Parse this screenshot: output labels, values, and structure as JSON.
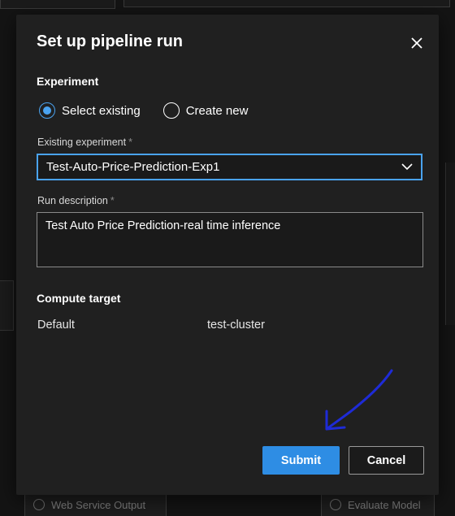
{
  "dialog": {
    "title": "Set up pipeline run",
    "close_icon": "close-icon",
    "experiment_section": "Experiment",
    "radio_options": [
      {
        "label": "Select existing",
        "selected": true
      },
      {
        "label": "Create new",
        "selected": false
      }
    ],
    "existing_experiment_label": "Existing experiment",
    "existing_experiment_value": "Test-Auto-Price-Prediction-Exp1",
    "run_description_label": "Run description",
    "run_description_value": "Test Auto Price Prediction-real time inference",
    "required_marker": "*",
    "compute_section": "Compute target",
    "compute_key": "Default",
    "compute_value": "test-cluster",
    "submit_label": "Submit",
    "cancel_label": "Cancel"
  },
  "background": {
    "node_1_label": "Web Service Output",
    "node_2_label": "Evaluate Model"
  },
  "colors": {
    "accent": "#2e8de4",
    "focus": "#4aa3f0",
    "dialog_bg": "#202020",
    "annotation_arrow": "#1e2bd6"
  }
}
